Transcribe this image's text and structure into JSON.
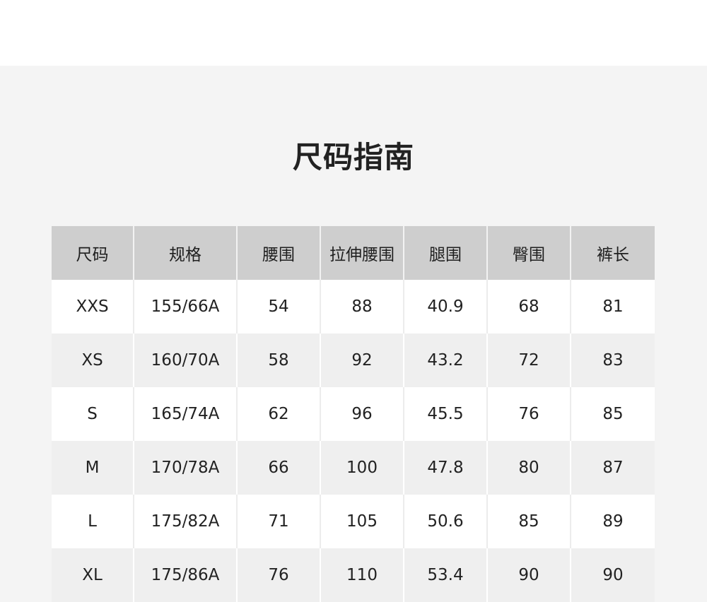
{
  "title": "尺码指南",
  "table": {
    "headers": [
      "尺码",
      "规格",
      "腰围",
      "拉伸腰围",
      "腿围",
      "臀围",
      "裤长"
    ],
    "rows": [
      [
        "XXS",
        "155/66A",
        "54",
        "88",
        "40.9",
        "68",
        "81"
      ],
      [
        "XS",
        "160/70A",
        "58",
        "92",
        "43.2",
        "72",
        "83"
      ],
      [
        "S",
        "165/74A",
        "62",
        "96",
        "45.5",
        "76",
        "85"
      ],
      [
        "M",
        "170/78A",
        "66",
        "100",
        "47.8",
        "80",
        "87"
      ],
      [
        "L",
        "175/82A",
        "71",
        "105",
        "50.6",
        "85",
        "89"
      ],
      [
        "XL",
        "175/86A",
        "76",
        "110",
        "53.4",
        "90",
        "90"
      ]
    ]
  },
  "colors": {
    "panel_background": "#f4f4f4",
    "header_background": "#cecece",
    "row_alt_background": "#efefef",
    "row_background": "#ffffff",
    "text": "#1f1f1f"
  }
}
